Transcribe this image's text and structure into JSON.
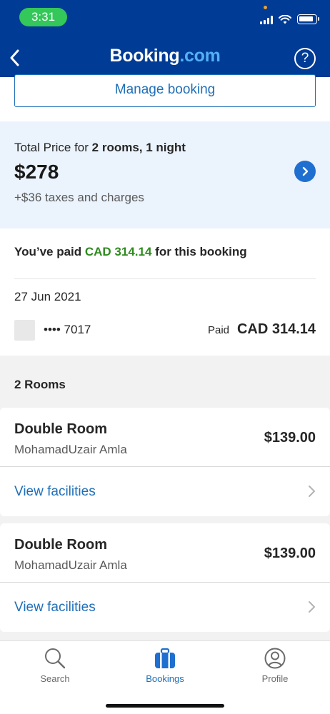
{
  "status_bar": {
    "time": "3:31"
  },
  "header": {
    "logo_main": "Booking",
    "logo_suffix": ".com",
    "help_symbol": "?"
  },
  "manage_label": "Manage booking",
  "total": {
    "prefix": "Total Price for ",
    "rooms_nights": "2 rooms, 1 night",
    "amount": "$278",
    "taxes": "+$36 taxes and charges"
  },
  "payment": {
    "line_prefix": "You’ve paid ",
    "line_amount": "CAD 314.14",
    "line_suffix": " for this booking",
    "date": "27 Jun 2021",
    "card_masked": "•••• 7017",
    "paid_label": "Paid",
    "paid_amount": "CAD 314.14"
  },
  "rooms_heading": "2 Rooms",
  "rooms": [
    {
      "title": "Double Room",
      "guest": "MohamadUzair Amla",
      "price": "$139.00",
      "link": "View facilities"
    },
    {
      "title": "Double Room",
      "guest": "MohamadUzair Amla",
      "price": "$139.00",
      "link": "View facilities"
    }
  ],
  "tabs": [
    {
      "label": "Search",
      "icon": "search-icon",
      "active": false
    },
    {
      "label": "Bookings",
      "icon": "suitcase-icon",
      "active": true
    },
    {
      "label": "Profile",
      "icon": "profile-icon",
      "active": false
    }
  ],
  "colors": {
    "brand_blue": "#003b95",
    "link_blue": "#1f6fb8",
    "paid_green": "#2e8b1e",
    "price_panel": "#ebf3fd"
  }
}
